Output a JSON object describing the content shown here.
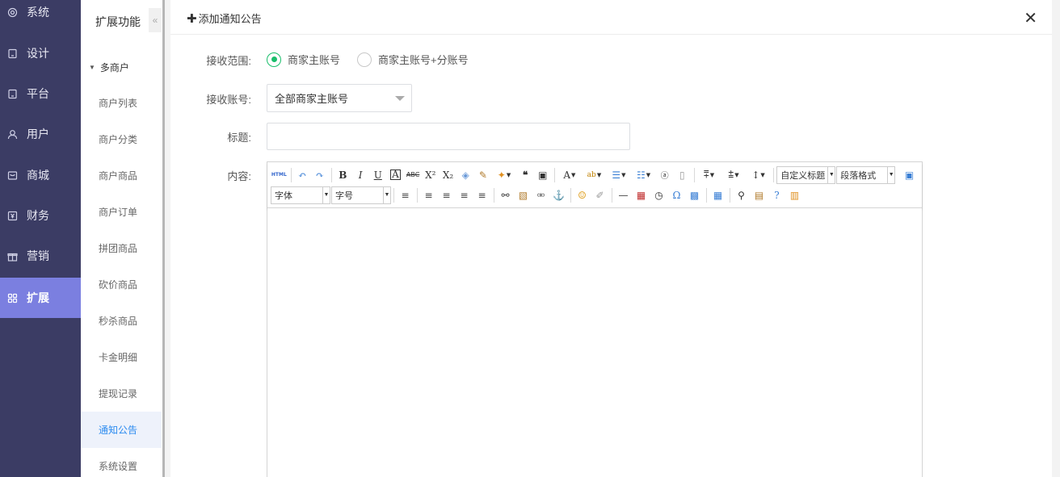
{
  "nav": {
    "items": [
      {
        "label": "系统",
        "icon": "gear-icon"
      },
      {
        "label": "设计",
        "icon": "design-icon"
      },
      {
        "label": "平台",
        "icon": "tablet-icon"
      },
      {
        "label": "用户",
        "icon": "user-icon"
      },
      {
        "label": "商城",
        "icon": "mall-icon"
      },
      {
        "label": "财务",
        "icon": "finance-icon"
      },
      {
        "label": "营销",
        "icon": "gift-icon"
      },
      {
        "label": "扩展",
        "icon": "grid-icon"
      }
    ],
    "active_index": 7,
    "colors": {
      "bg": "#3b3c64",
      "active": "#7b7fe0"
    }
  },
  "subnav": {
    "title": "扩展功能",
    "collapse_glyph": "«",
    "group": "多商户",
    "items": [
      "商户列表",
      "商户分类",
      "商户商品",
      "商户订单",
      "拼团商品",
      "砍价商品",
      "秒杀商品",
      "卡金明细",
      "提现记录",
      "通知公告",
      "系统设置"
    ],
    "active_index": 9,
    "active_color": "#2d8cf0"
  },
  "panel": {
    "title": "添加通知公告",
    "close_glyph": "✕"
  },
  "form": {
    "scope_label": "接收范围:",
    "scope_options": [
      "商家主账号",
      "商家主账号+分账号"
    ],
    "scope_selected": 0,
    "account_label": "接收账号:",
    "account_value": "全部商家主账号",
    "title_label": "标题:",
    "title_value": "",
    "content_label": "内容:"
  },
  "editor": {
    "html_btn": "HTML",
    "font_family": "字体",
    "font_size": "字号",
    "custom_heading": "自定义标题",
    "paragraph_format": "段落格式"
  },
  "accent_color": "#19be6b"
}
